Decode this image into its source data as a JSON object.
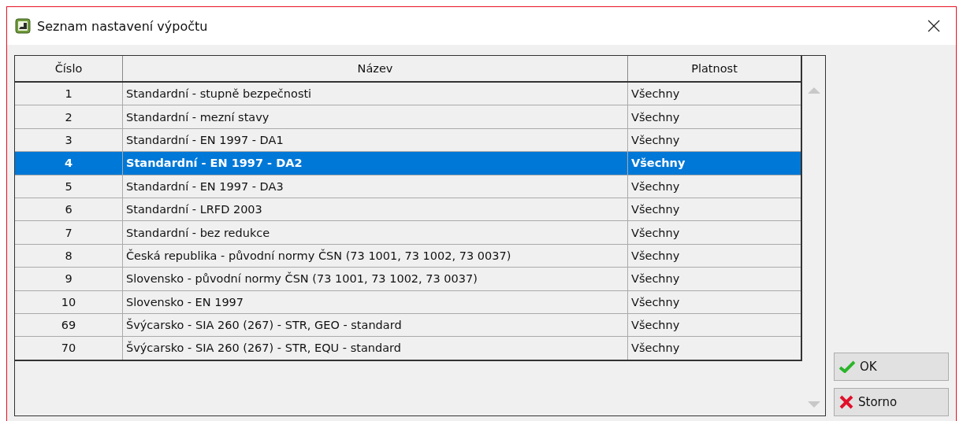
{
  "window": {
    "title": "Seznam nastavení výpočtu"
  },
  "table": {
    "columns": [
      "Číslo",
      "Název",
      "Platnost"
    ],
    "rows": [
      {
        "number": "1",
        "name": "Standardní - stupně bezpečnosti",
        "validity": "Všechny",
        "selected": false
      },
      {
        "number": "2",
        "name": "Standardní - mezní stavy",
        "validity": "Všechny",
        "selected": false
      },
      {
        "number": "3",
        "name": "Standardní - EN 1997 - DA1",
        "validity": "Všechny",
        "selected": false
      },
      {
        "number": "4",
        "name": "Standardní - EN 1997 - DA2",
        "validity": "Všechny",
        "selected": true
      },
      {
        "number": "5",
        "name": "Standardní - EN 1997 - DA3",
        "validity": "Všechny",
        "selected": false
      },
      {
        "number": "6",
        "name": "Standardní - LRFD 2003",
        "validity": "Všechny",
        "selected": false
      },
      {
        "number": "7",
        "name": "Standardní - bez redukce",
        "validity": "Všechny",
        "selected": false
      },
      {
        "number": "8",
        "name": "Česká republika - původní normy ČSN (73 1001, 73 1002, 73 0037)",
        "validity": "Všechny",
        "selected": false
      },
      {
        "number": "9",
        "name": "Slovensko - původní normy ČSN (73 1001, 73 1002, 73 0037)",
        "validity": "Všechny",
        "selected": false
      },
      {
        "number": "10",
        "name": "Slovensko - EN 1997",
        "validity": "Všechny",
        "selected": false
      },
      {
        "number": "69",
        "name": "Švýcarsko - SIA 260 (267) - STR, GEO - standard",
        "validity": "Všechny",
        "selected": false
      },
      {
        "number": "70",
        "name": "Švýcarsko - SIA 260 (267) - STR, EQU - standard",
        "validity": "Všechny",
        "selected": false
      }
    ]
  },
  "buttons": [
    {
      "kind": "ok",
      "label": "OK"
    },
    {
      "kind": "cancel",
      "label": "Storno"
    }
  ]
}
